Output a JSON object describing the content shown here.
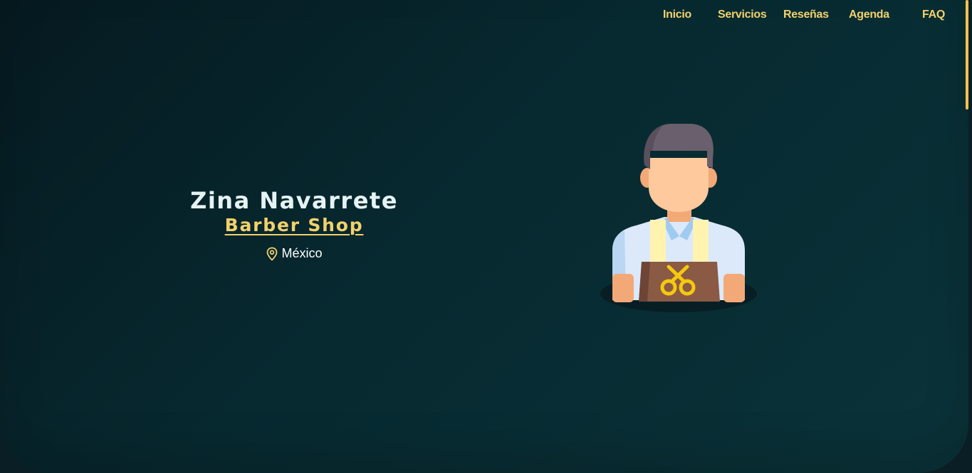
{
  "nav": {
    "items": [
      {
        "label": "Inicio"
      },
      {
        "label": "Servicios"
      },
      {
        "label": "Reseñas"
      },
      {
        "label": "Agenda"
      },
      {
        "label": "FAQ"
      }
    ]
  },
  "hero": {
    "name": "Zina Navarrete",
    "subtitle": "Barber Shop",
    "location": "México",
    "location_icon": "map-pin-icon",
    "illustration": "barber-avatar-illustration"
  },
  "colors": {
    "accent": "#f2d16b",
    "background_start": "#061a20",
    "background_end": "#0a3339",
    "text_light": "#e6f3f5"
  }
}
